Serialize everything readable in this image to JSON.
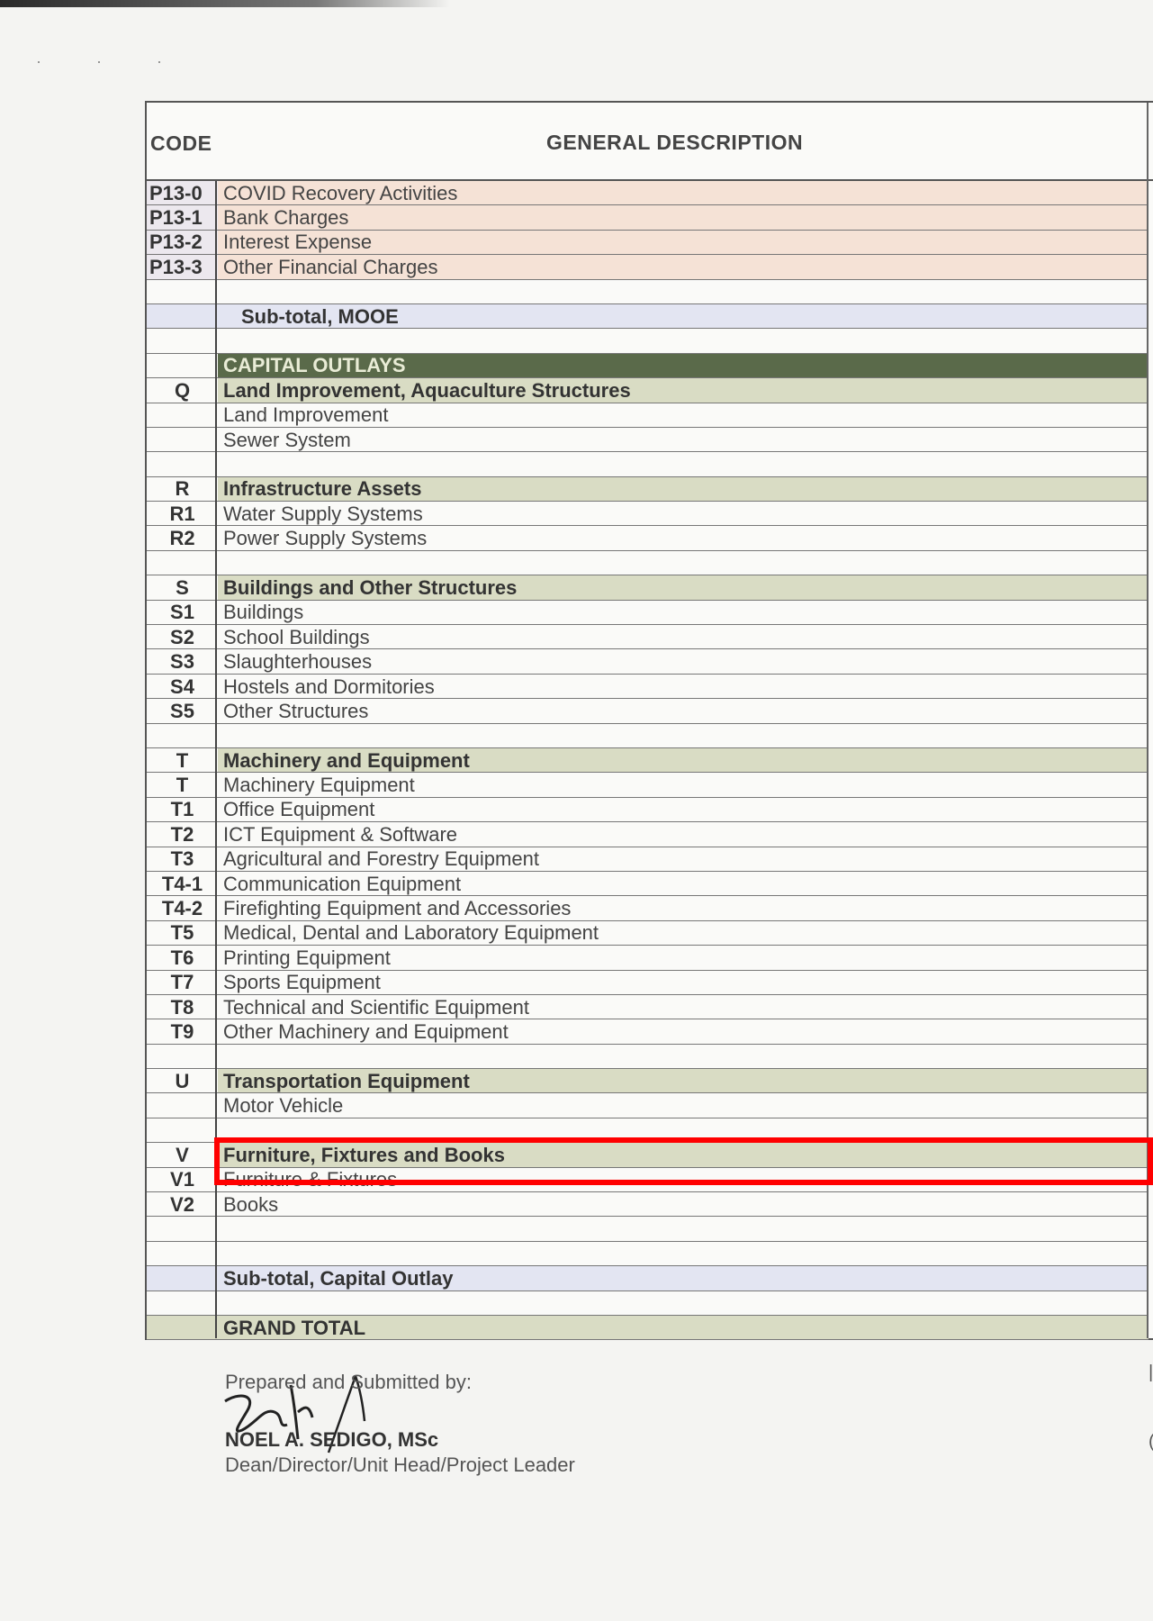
{
  "header": {
    "code_label": "CODE",
    "description_label": "GENERAL DESCRIPTION"
  },
  "rows": [
    {
      "type": "peach",
      "code": "P13-0",
      "desc": "COVID Recovery Activities"
    },
    {
      "type": "peach",
      "code": "P13-1",
      "desc": "Bank Charges"
    },
    {
      "type": "peach",
      "code": "P13-2",
      "desc": "Interest Expense"
    },
    {
      "type": "peach",
      "code": "P13-3",
      "desc": "Other Financial Charges"
    },
    {
      "type": "blank",
      "code": "",
      "desc": ""
    },
    {
      "type": "subtotal",
      "code": "",
      "desc": "Sub-total, MOOE",
      "indent": true
    },
    {
      "type": "blank",
      "code": "",
      "desc": ""
    },
    {
      "type": "capital",
      "code": "",
      "desc": "CAPITAL OUTLAYS"
    },
    {
      "type": "cat",
      "code": "Q",
      "desc": "Land  Improvement, Aquaculture Structures"
    },
    {
      "type": "item",
      "code": "",
      "desc": "Land Improvement"
    },
    {
      "type": "item",
      "code": "",
      "desc": "Sewer System"
    },
    {
      "type": "blank",
      "code": "",
      "desc": ""
    },
    {
      "type": "cat",
      "code": "R",
      "desc": "Infrastructure Assets"
    },
    {
      "type": "item",
      "code": "R1",
      "desc": "Water Supply Systems"
    },
    {
      "type": "item",
      "code": "R2",
      "desc": "Power  Supply  Systems"
    },
    {
      "type": "blank",
      "code": "",
      "desc": ""
    },
    {
      "type": "cat",
      "code": "S",
      "desc": "Buildings and Other Structures"
    },
    {
      "type": "item",
      "code": "S1",
      "desc": "Buildings"
    },
    {
      "type": "item",
      "code": "S2",
      "desc": "School Buildings"
    },
    {
      "type": "item",
      "code": "S3",
      "desc": "Slaughterhouses"
    },
    {
      "type": "item",
      "code": "S4",
      "desc": "Hostels and Dormitories"
    },
    {
      "type": "item",
      "code": "S5",
      "desc": "Other Structures"
    },
    {
      "type": "blank",
      "code": "",
      "desc": ""
    },
    {
      "type": "cat",
      "code": "T",
      "desc": "Machinery and Equipment"
    },
    {
      "type": "item",
      "code": "T",
      "desc": "Machinery Equipment"
    },
    {
      "type": "item",
      "code": "T1",
      "desc": "Office Equipment"
    },
    {
      "type": "item",
      "code": "T2",
      "desc": "ICT Equipment & Software"
    },
    {
      "type": "item",
      "code": "T3",
      "desc": "Agricultural and Forestry Equipment"
    },
    {
      "type": "item",
      "code": "T4-1",
      "desc": "Communication Equipment"
    },
    {
      "type": "item",
      "code": "T4-2",
      "desc": "Firefighting Equipment and Accessories"
    },
    {
      "type": "item",
      "code": "T5",
      "desc": "Medical, Dental and Laboratory Equipment"
    },
    {
      "type": "item",
      "code": "T6",
      "desc": "Printing Equipment"
    },
    {
      "type": "item",
      "code": "T7",
      "desc": "Sports Equipment"
    },
    {
      "type": "item",
      "code": "T8",
      "desc": "Technical and Scientific Equipment"
    },
    {
      "type": "item",
      "code": "T9",
      "desc": "Other Machinery and Equipment"
    },
    {
      "type": "blank",
      "code": "",
      "desc": ""
    },
    {
      "type": "cat",
      "code": "U",
      "desc": "Transportation Equipment"
    },
    {
      "type": "item",
      "code": "",
      "desc": "Motor Vehicle"
    },
    {
      "type": "blank",
      "code": "",
      "desc": ""
    },
    {
      "type": "cat",
      "code": "V",
      "desc": "Furniture, Fixtures and Books"
    },
    {
      "type": "item",
      "code": "V1",
      "desc": "Furniture & Fixtures"
    },
    {
      "type": "item",
      "code": "V2",
      "desc": "Books"
    },
    {
      "type": "blank",
      "code": "",
      "desc": ""
    },
    {
      "type": "blank",
      "code": "",
      "desc": ""
    },
    {
      "type": "subtotal",
      "code": "",
      "desc": "Sub-total, Capital Outlay"
    },
    {
      "type": "blank",
      "code": "",
      "desc": ""
    },
    {
      "type": "grand",
      "code": "",
      "desc": "GRAND TOTAL"
    }
  ],
  "signature": {
    "prepared_label": "Prepared and Submitted by:",
    "name": "NOEL A. SEDIGO, MSc",
    "role": "Dean/Director/Unit Head/Project Leader"
  },
  "colors": {
    "highlight": "#ff0000",
    "category_fill": "#d9dcc4",
    "capital_fill": "#5a6a4a",
    "peach_fill": "#f5e2d6",
    "subtotal_fill": "#e3e5f2"
  }
}
